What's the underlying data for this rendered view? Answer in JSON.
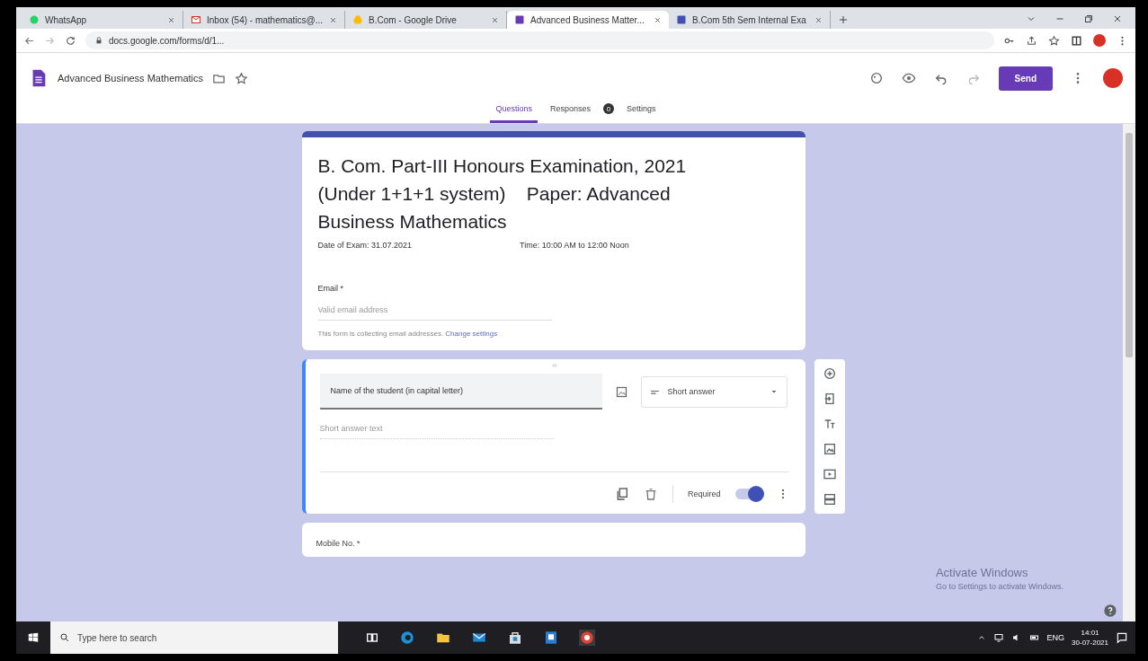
{
  "browser": {
    "tabs": [
      {
        "title": "WhatsApp",
        "selected": false
      },
      {
        "title": "Inbox (54) - mathematics@...",
        "selected": false
      },
      {
        "title": "B.Com - Google Drive",
        "selected": false
      },
      {
        "title": "Advanced Business Matter...",
        "selected": true
      },
      {
        "title": "B.Com 5th Sem Internal Exa",
        "selected": false
      }
    ],
    "address": "docs.google.com/forms/d/1..."
  },
  "form_header": {
    "title": "Advanced Business Mathematics",
    "send": "Send",
    "tabs": [
      {
        "label": "Questions",
        "selected": true
      },
      {
        "label": "Responses",
        "selected": false,
        "badge": "0"
      },
      {
        "label": "Settings",
        "selected": false
      }
    ]
  },
  "header_card": {
    "title": "B. Com. Part-III Honours Examination, 2021  (Under 1+1+1 system)    Paper: Advanced Business Mathematics",
    "details": [
      "Date of Exam: 31.07.2021",
      "Time: 10:00 AM to 12:00 Noon"
    ],
    "email": {
      "label": "Email *",
      "placeholder": "Valid email address",
      "note": "This form is collecting email addresses.",
      "link": "Change settings"
    }
  },
  "question": {
    "title": "Name of the student (in capital letter)",
    "type": "Short answer",
    "answer_placeholder": "Short answer text",
    "required_label": "Required",
    "required": true
  },
  "next_question": {
    "title": "Mobile No. *"
  },
  "activation": {
    "title": "Activate Windows",
    "text": "Go to Settings to activate Windows."
  },
  "taskbar": {
    "search": "Type here to search",
    "language": "ENG",
    "time": "14:01",
    "date": "30-07-2021"
  }
}
